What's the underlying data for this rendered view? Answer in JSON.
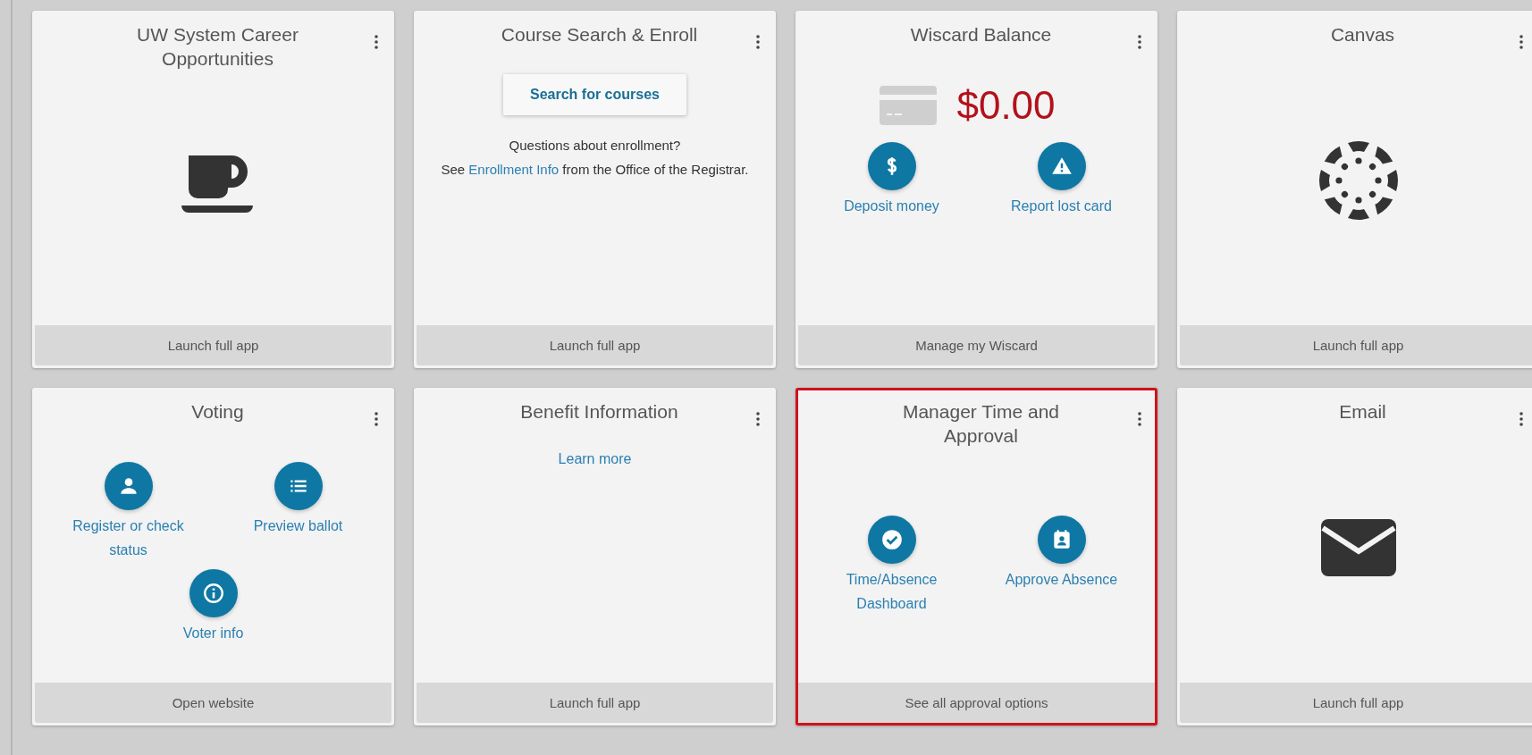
{
  "cards": [
    {
      "kind": "icon",
      "title": "UW System Career Opportunities",
      "footer": "Launch full app",
      "highlighted": false
    },
    {
      "kind": "search",
      "title": "Course Search & Enroll",
      "button": "Search for courses",
      "question": "Questions about enrollment?",
      "before": "See ",
      "link": "Enrollment Info",
      "after": " from the Office of the Registrar.",
      "footer": "Launch full app",
      "highlighted": false
    },
    {
      "kind": "balance",
      "title": "Wiscard Balance",
      "balance": "$0.00",
      "actions": [
        {
          "label": "Deposit money"
        },
        {
          "label": "Report lost card"
        }
      ],
      "footer": "Manage my Wiscard",
      "highlighted": false
    },
    {
      "kind": "icon",
      "title": "Canvas",
      "footer": "Launch full app",
      "highlighted": false
    },
    {
      "kind": "actions",
      "title": "Voting",
      "actions": [
        {
          "label": "Register or check status"
        },
        {
          "label": "Preview ballot"
        },
        {
          "label": "Voter info"
        }
      ],
      "footer": "Open website",
      "highlighted": false
    },
    {
      "kind": "links",
      "title": "Benefit Information",
      "link": "Learn more",
      "footer": "Launch full app",
      "highlighted": false
    },
    {
      "kind": "actions",
      "title": "Manager Time and Approval",
      "actions": [
        {
          "label": "Time/Absence Dashboard"
        },
        {
          "label": "Approve Absence"
        }
      ],
      "footer": "See all approval options",
      "highlighted": true
    },
    {
      "kind": "icon",
      "title": "Email",
      "footer": "Launch full app",
      "highlighted": false
    }
  ]
}
